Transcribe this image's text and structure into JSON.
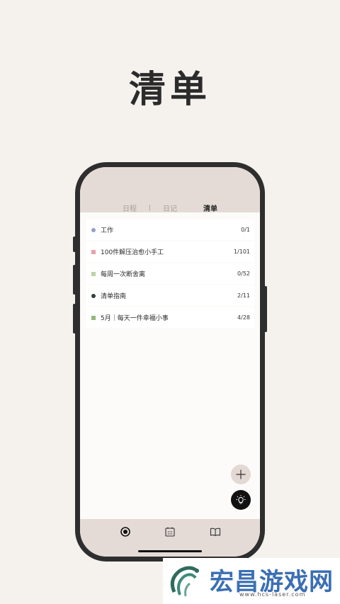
{
  "hero": {
    "title": "清单"
  },
  "tabs": [
    {
      "label": "日程",
      "active": false
    },
    {
      "label": "日记",
      "active": false
    },
    {
      "label": "清单",
      "active": true
    }
  ],
  "lists": [
    {
      "label": "工作",
      "count": "0/1",
      "color": "#94a0cf",
      "marker": "circle"
    },
    {
      "label": "100件解压治愈小手工",
      "count": "1/101",
      "color": "#e8a0ad",
      "marker": "square"
    },
    {
      "label": "每周一次断舍离",
      "count": "0/52",
      "color": "#bcd3a6",
      "marker": "square"
    },
    {
      "label": "清单指南",
      "count": "2/11",
      "color": "#33403a",
      "marker": "circle"
    },
    {
      "label": "5月｜每天一件幸福小事",
      "count": "4/28",
      "color": "#92b87a",
      "marker": "square"
    }
  ],
  "fabs": {
    "add": "plus-icon",
    "idea": "lightbulb-icon"
  },
  "bottom_nav": [
    {
      "icon": "circle-dot-icon"
    },
    {
      "icon": "calendar-icon"
    },
    {
      "icon": "book-icon"
    }
  ],
  "watermark": {
    "title": "宏昌游戏网",
    "url": "www.hcs-laser.com"
  }
}
